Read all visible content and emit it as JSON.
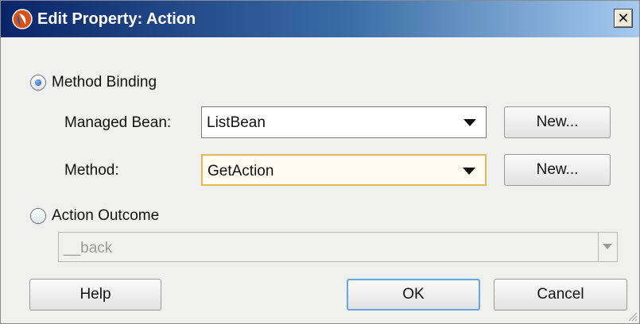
{
  "window": {
    "title": "Edit Property: Action",
    "close_symbol": "✕",
    "title_icon": "oracle-jdev-icon",
    "close_icon": "close-icon"
  },
  "method_binding": {
    "label": "Method Binding",
    "selected": true,
    "managed_bean": {
      "label": "Managed Bean:",
      "value": "ListBean",
      "new_button": "New..."
    },
    "method": {
      "label": "Method:",
      "value": "GetAction",
      "new_button": "New..."
    }
  },
  "action_outcome": {
    "label": "Action Outcome",
    "selected": false,
    "value": "__back"
  },
  "buttons": {
    "help": "Help",
    "ok": "OK",
    "cancel": "Cancel"
  },
  "colors": {
    "title_gradient_start": "#0a246a",
    "title_gradient_end": "#a6caf0",
    "focus_border": "#e6b65a",
    "default_button_border": "#6aa6e2"
  }
}
